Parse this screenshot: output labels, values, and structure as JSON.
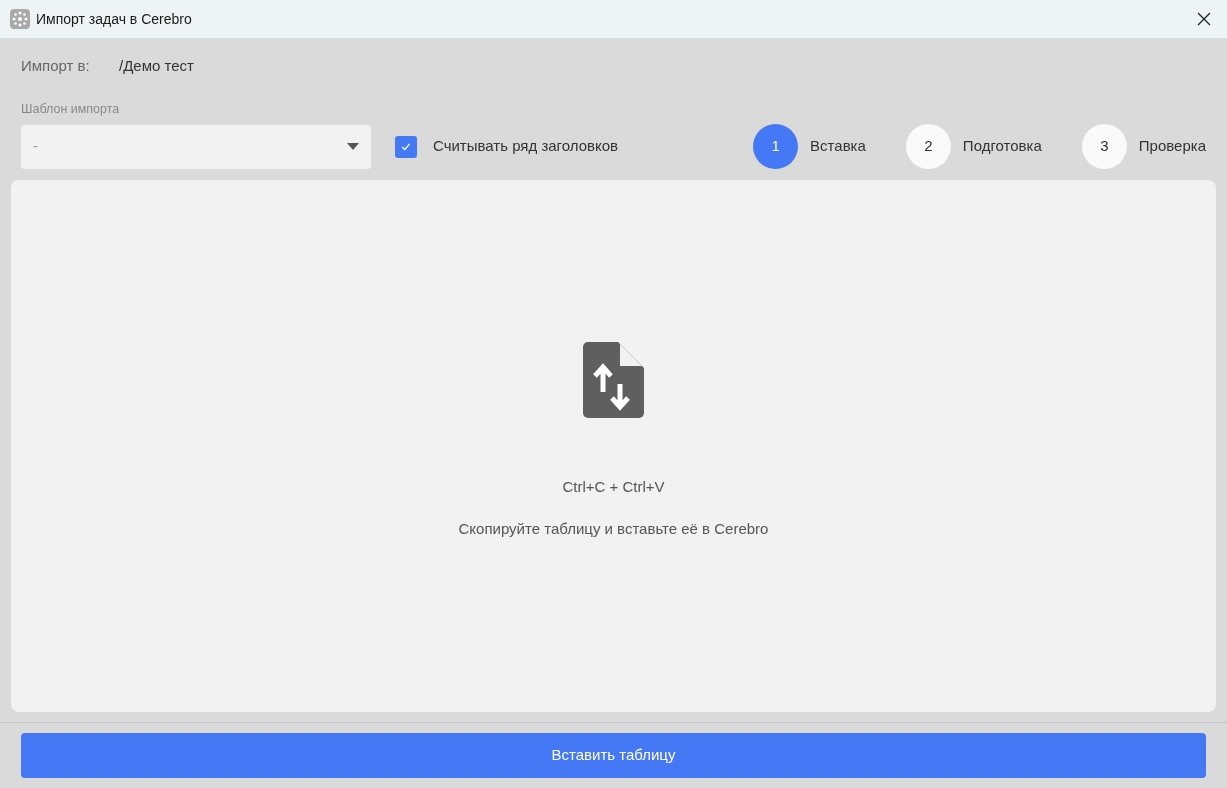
{
  "window": {
    "title": "Импорт задач в Cerebro"
  },
  "import_target": {
    "label": "Импорт в:",
    "value": "/Демо тест"
  },
  "template": {
    "label": "Шаблон импорта",
    "value": "-"
  },
  "header_row_checkbox": {
    "label": "Считывать ряд заголовков",
    "checked": true
  },
  "steps": [
    {
      "number": "1",
      "label": "Вставка",
      "selected": true
    },
    {
      "number": "2",
      "label": "Подготовка",
      "selected": false
    },
    {
      "number": "3",
      "label": "Проверка",
      "selected": false
    }
  ],
  "drop_zone": {
    "shortcut": "Ctrl+C + Ctrl+V",
    "hint": "Скопируйте таблицу и вставьте её в Cerebro"
  },
  "primary_button": "Вставить таблицу"
}
